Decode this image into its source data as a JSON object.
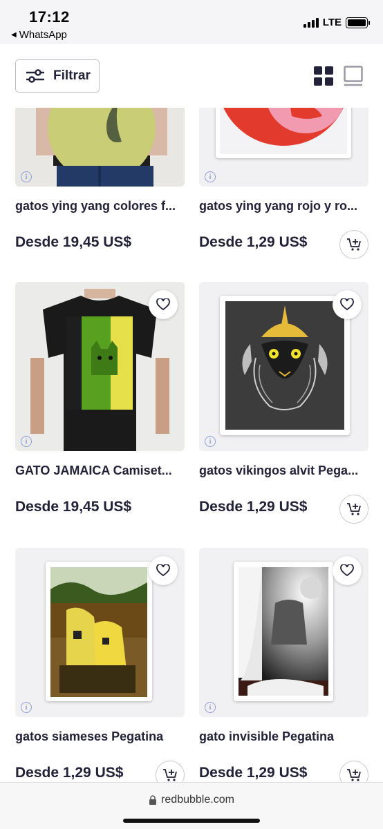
{
  "status_bar": {
    "time": "17:12",
    "back_app": "WhatsApp",
    "network": "LTE"
  },
  "toolbar": {
    "filter_label": "Filtrar",
    "icons": {
      "filter": "sliders-icon",
      "grid_view": "grid-view-icon",
      "single_view": "single-view-icon"
    }
  },
  "products": [
    {
      "title": "gatos ying yang colores f...",
      "price": "Desde 19,45 US$",
      "cart": false
    },
    {
      "title": "gatos ying yang rojo y ro...",
      "price": "Desde 1,29 US$",
      "cart": true
    },
    {
      "title": "GATO JAMAICA Camiset...",
      "price": "Desde 19,45 US$",
      "cart": false
    },
    {
      "title": "gatos vikingos alvit Pega...",
      "price": "Desde 1,29 US$",
      "cart": true
    },
    {
      "title": "gatos siameses Pegatina",
      "price": "Desde 1,29 US$",
      "cart": true
    },
    {
      "title": "gato invisible Pegatina",
      "price": "Desde 1,29 US$",
      "cart": true
    }
  ],
  "address_bar": {
    "url": "redbubble.com"
  },
  "colors": {
    "text": "#222238",
    "thumb_bg": "#f1f1f3",
    "accent_info": "#8ca0d8"
  }
}
